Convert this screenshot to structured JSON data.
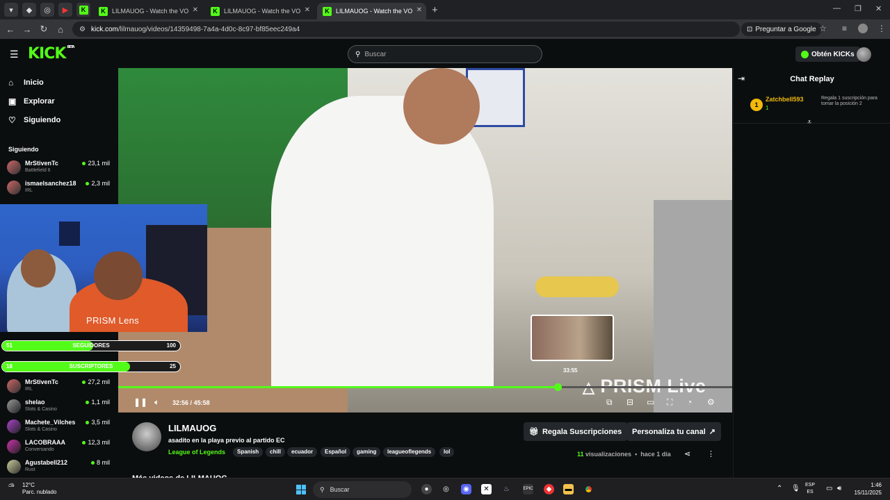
{
  "browser": {
    "tabs": [
      {
        "title": "LILMAUOG - Watch the VOD on"
      },
      {
        "title": "LILMAUOG - Watch the VOD on"
      },
      {
        "title": "LILMAUOG - Watch the VOD on",
        "active": true
      }
    ],
    "url_host": "kick.com",
    "url_path": "/lilmauog/videos/14359498-7a4a-4d0c-8c97-bf85eec249a4",
    "ask_google": "Preguntar a Google"
  },
  "header": {
    "logo": "KICK",
    "logo_badge": "BETA",
    "search_placeholder": "Buscar",
    "kicks_button": "Obtén KICKs"
  },
  "sidebar": {
    "nav": [
      {
        "label": "Inicio",
        "icon": "home-icon"
      },
      {
        "label": "Explorar",
        "icon": "explore-icon"
      },
      {
        "label": "Siguiendo",
        "icon": "heart-icon"
      }
    ],
    "following_heading": "Siguiendo",
    "channels_top": [
      {
        "name": "MrStivenTc",
        "category": "Battlefield 6",
        "viewers": "23,1 mil"
      },
      {
        "name": "ismaelsanchez18",
        "category": "IRL",
        "viewers": "2,3 mil"
      }
    ],
    "channels_bottom": [
      {
        "name": "MrStivenTc",
        "category": "IRL",
        "viewers": "27,2 mil"
      },
      {
        "name": "shelao",
        "category": "Slots & Casino",
        "viewers": "1,1 mil"
      },
      {
        "name": "Machete_Vilches",
        "category": "Slots & Casino",
        "viewers": "3,5 mil"
      },
      {
        "name": "LACOBRAAA",
        "category": "Conversando",
        "viewers": "12,3 mil"
      },
      {
        "name": "Agustabell212",
        "category": "Rust",
        "viewers": "8 mil"
      }
    ]
  },
  "overlay": {
    "lens_label": "PRISM Lens",
    "goals": [
      {
        "label": "SEGUIDORES",
        "current": "51",
        "target": "100",
        "progress": 0.51
      },
      {
        "label": "SUSCRIPTORES",
        "current": "18",
        "target": "25",
        "progress": 0.72
      }
    ]
  },
  "player": {
    "current_time": "32:56",
    "duration": "45:58",
    "time_separator": "/",
    "progress": 0.716,
    "hover_time": "33:55",
    "watermark": "PRISM Live"
  },
  "video_info": {
    "channel": "LILMAUOG",
    "title": "asadito en la playa previo al partido EC",
    "category": "League of Legends",
    "tags": [
      "Spanish",
      "chill",
      "ecuador",
      "Español",
      "gaming",
      "leagueoflegends",
      "lol"
    ],
    "gift_subs_button": "Regala Suscripciones",
    "customize_button": "Personaliza tu canal",
    "views_count": "11",
    "views_label": "visualizaciones",
    "age": "hace 1 día",
    "more_videos": "Más videos de LILMAUOG"
  },
  "chat": {
    "title": "Chat Replay",
    "rank": "1",
    "gifter": "Zatchbell593",
    "gift_count": "1",
    "gift_text": "Regala 1 suscripción para tomar la posición 2"
  },
  "taskbar": {
    "temperature": "12°C",
    "weather": "Parc. nublado",
    "search": "Buscar",
    "lang_top": "ESP",
    "lang_bottom": "ES",
    "time": "1:46",
    "date": "15/11/2025"
  },
  "colors": {
    "accent": "#53fc18",
    "gold": "#f0b90b",
    "background": "#0b0e0f"
  }
}
